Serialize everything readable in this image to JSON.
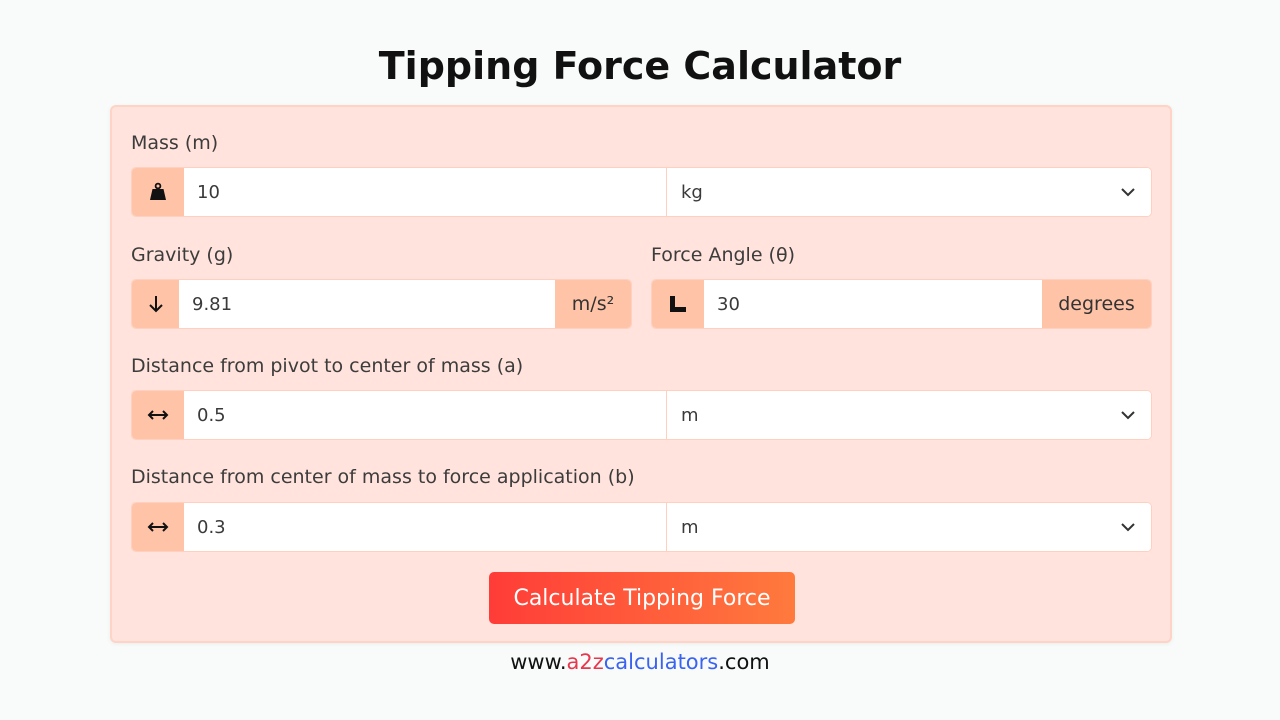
{
  "page": {
    "title": "Tipping Force Calculator"
  },
  "form": {
    "mass": {
      "label": "Mass (m)",
      "icon": "weight-icon",
      "value": "10",
      "unit": "kg"
    },
    "gravity": {
      "label": "Gravity (g)",
      "icon": "arrow-down-icon",
      "value": "9.81",
      "unit": "m/s²"
    },
    "angle": {
      "label": "Force Angle (θ)",
      "icon": "ruler-angle-icon",
      "value": "30",
      "unit": "degrees"
    },
    "distance_a": {
      "label": "Distance from pivot to center of mass (a)",
      "icon": "arrows-horizontal-icon",
      "value": "0.5",
      "unit": "m"
    },
    "distance_b": {
      "label": "Distance from center of mass to force application (b)",
      "icon": "arrows-horizontal-icon",
      "value": "0.3",
      "unit": "m"
    },
    "submit_label": "Calculate Tipping Force"
  },
  "footer": {
    "prefix": "www.",
    "brand_a2z": "a2z",
    "brand_rest": "calculators",
    "suffix": ".com"
  },
  "colors": {
    "card_bg": "#ffe3dc",
    "addon_bg": "#ffc4a8",
    "button_start": "#ff3c38",
    "button_end": "#ff7a3d",
    "brand_blue": "#3a63f0",
    "brand_red": "#e8364d"
  }
}
